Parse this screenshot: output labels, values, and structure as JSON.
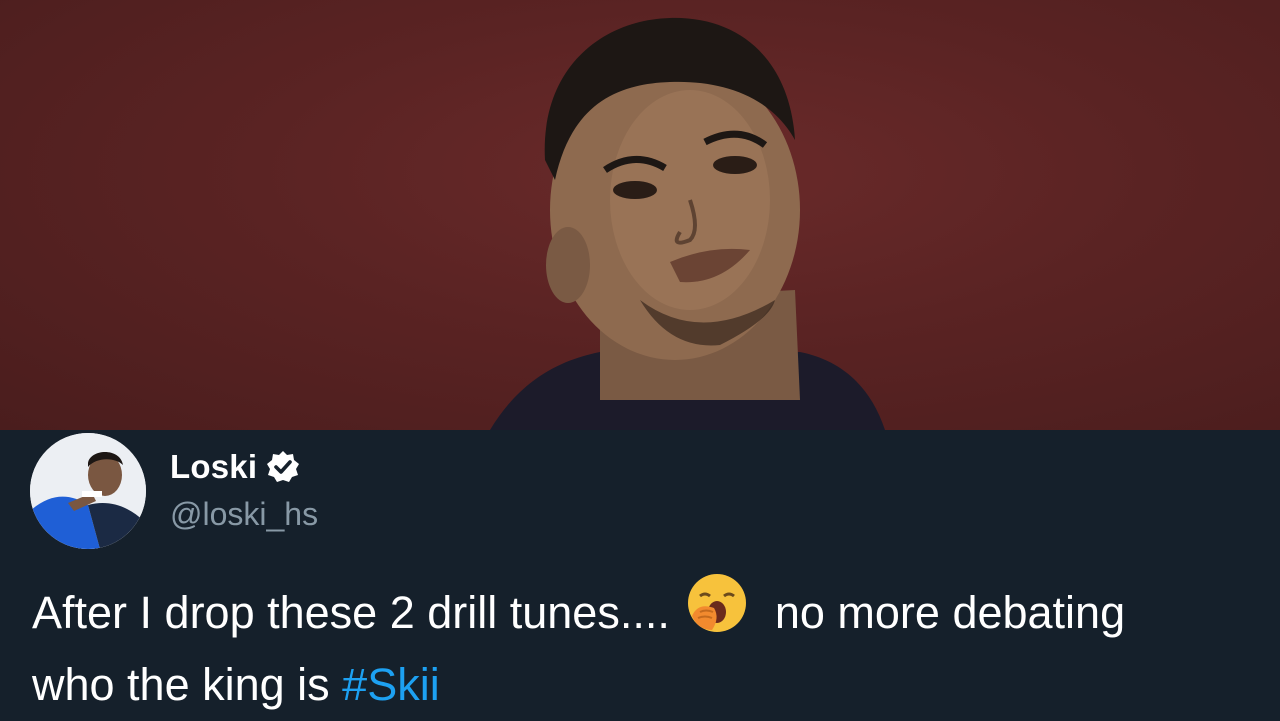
{
  "tweet": {
    "display_name": "Loski",
    "handle": "@loski_hs",
    "verified": true,
    "text_line1_before_emoji": "After I drop these 2 drill tunes....",
    "emoji": "yawning-face-emoji",
    "text_line1_after_emoji": "no more debating",
    "text_line2": "who the king is ",
    "hashtag": "#Skii"
  },
  "colors": {
    "background": "#15202b",
    "hero_background": "#5a2323",
    "text": "#ffffff",
    "handle": "#8899a6",
    "hashtag": "#1da1f2"
  }
}
